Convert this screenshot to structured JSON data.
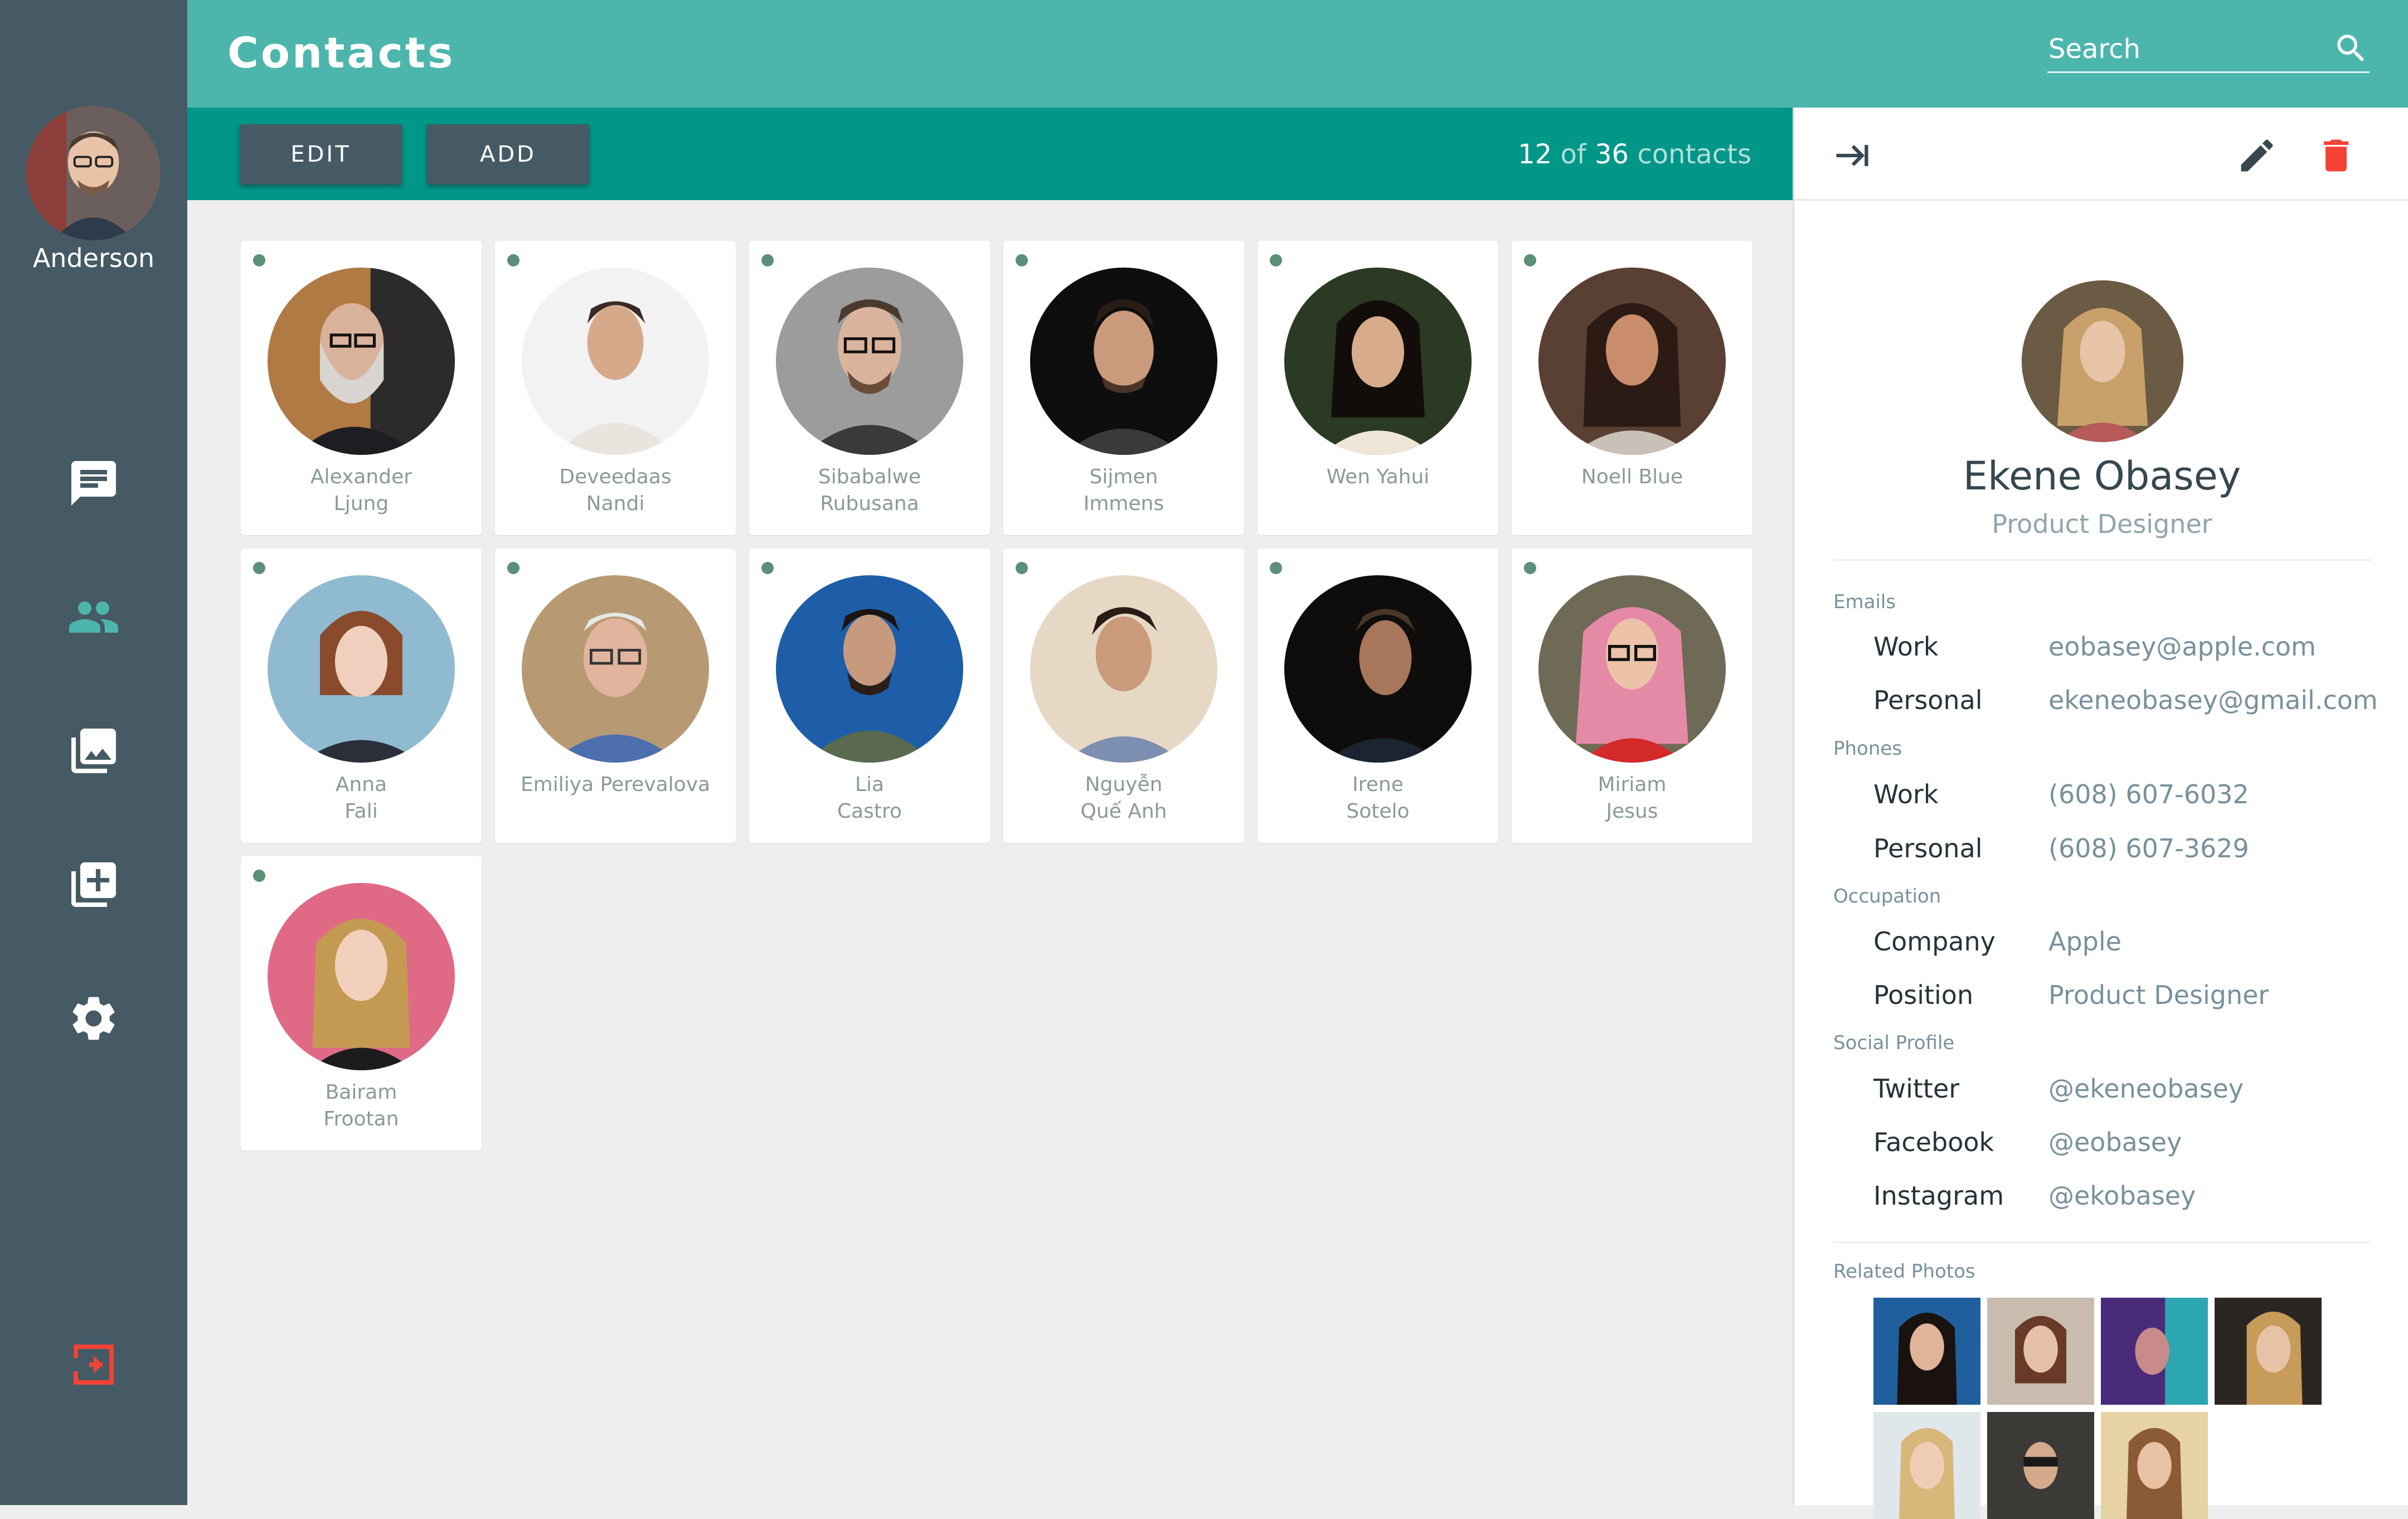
{
  "app": {
    "title": "Contacts"
  },
  "user": {
    "name": "Anderson"
  },
  "nav": {
    "items": [
      {
        "icon": "chat-icon",
        "color": "#ffffff"
      },
      {
        "icon": "people-icon",
        "color": "#4db6ac",
        "active": true
      },
      {
        "icon": "photo-library-icon",
        "color": "#ffffff"
      },
      {
        "icon": "add-to-library-icon",
        "color": "#ffffff"
      },
      {
        "icon": "settings-gear-icon",
        "color": "#ffffff"
      }
    ],
    "logout_icon": {
      "icon": "logout-icon",
      "color": "#f44336"
    }
  },
  "search": {
    "placeholder": "Search"
  },
  "toolbar": {
    "edit_label": "EDIT",
    "add_label": "ADD",
    "count_shown": "12",
    "count_of": "of",
    "count_total": "36",
    "count_suffix": "contacts"
  },
  "contacts": [
    {
      "line1": "Alexander",
      "line2": "Ljung"
    },
    {
      "line1": "Deveedaas",
      "line2": "Nandi"
    },
    {
      "line1": "Sibabalwe",
      "line2": "Rubusana"
    },
    {
      "line1": "Sijmen",
      "line2": "Immens"
    },
    {
      "line1": "Wen Yahui",
      "line2": ""
    },
    {
      "line1": "Noell Blue",
      "line2": ""
    },
    {
      "line1": "Anna",
      "line2": "Fali"
    },
    {
      "line1": "Emiliya Perevalova",
      "line2": ""
    },
    {
      "line1": "Lia",
      "line2": "Castro"
    },
    {
      "line1": "Nguyễn",
      "line2": "Quế Anh"
    },
    {
      "line1": "Irene",
      "line2": "Sotelo"
    },
    {
      "line1": "Miriam",
      "line2": "Jesus"
    },
    {
      "line1": "Bairam",
      "line2": "Frootan"
    }
  ],
  "detail": {
    "name": "Ekene Obasey",
    "role": "Product Designer",
    "sections": {
      "emails": {
        "title": "Emails",
        "work_label": "Work",
        "work_value": "eobasey@apple.com",
        "personal_label": "Personal",
        "personal_value": "ekeneobasey@gmail.com"
      },
      "phones": {
        "title": "Phones",
        "work_label": "Work",
        "work_value": "(608) 607-6032",
        "personal_label": "Personal",
        "personal_value": "(608) 607-3629"
      },
      "occupation": {
        "title": "Occupation",
        "company_label": "Company",
        "company_value": "Apple",
        "position_label": "Position",
        "position_value": "Product Designer"
      },
      "social": {
        "title": "Social Profile",
        "twitter_label": "Twitter",
        "twitter_value": "@ekeneobasey",
        "facebook_label": "Facebook",
        "facebook_value": "@eobasey",
        "instagram_label": "Instagram",
        "instagram_value": "@ekobasey"
      },
      "related": {
        "title": "Related Photos"
      }
    }
  },
  "colors": {
    "topbar": "#4db6ac",
    "toolbar": "#009688",
    "sidebar": "#455a64",
    "status_dot": "#5a8f78",
    "delete": "#f44336"
  }
}
